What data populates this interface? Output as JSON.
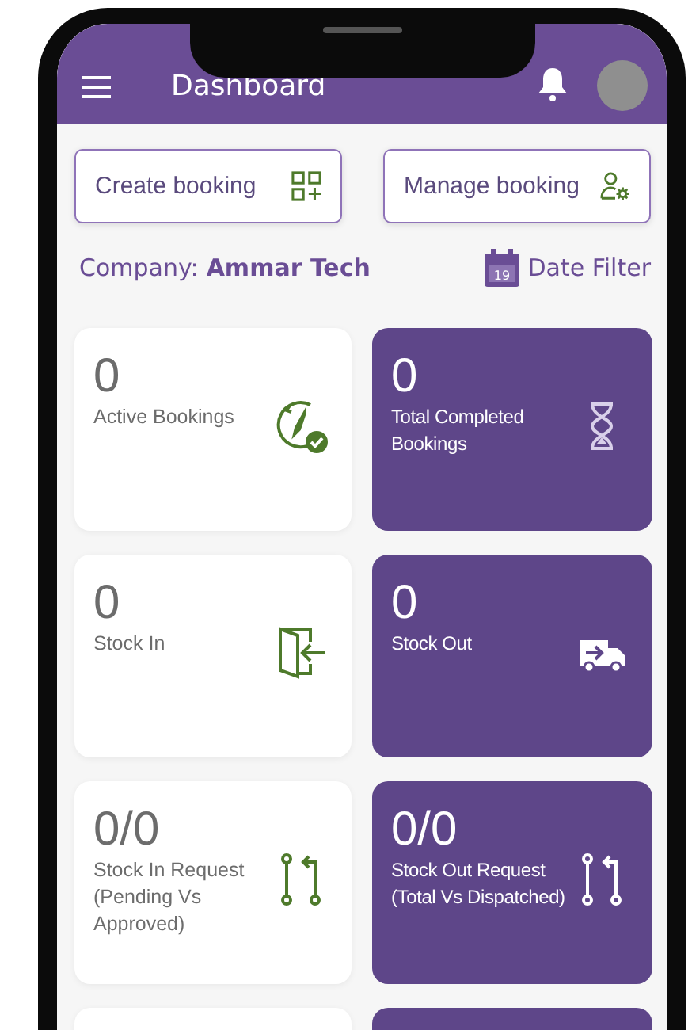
{
  "header": {
    "title": "Dashboard"
  },
  "actions": [
    {
      "label": "Create booking"
    },
    {
      "label": "Manage booking"
    }
  ],
  "company": {
    "label": "Company:",
    "value": "Ammar Tech"
  },
  "date_filter": {
    "label": "Date Filter",
    "day": "19"
  },
  "cards": [
    {
      "value": "0",
      "label": "Active Bookings"
    },
    {
      "value": "0",
      "label": "Total Completed Bookings"
    },
    {
      "value": "0",
      "label": "Stock In"
    },
    {
      "value": "0",
      "label": "Stock Out"
    },
    {
      "value": "0/0",
      "label": "Stock In Request (Pending Vs Approved)"
    },
    {
      "value": "0/0",
      "label": "Stock Out Request (Total Vs Dispatched)"
    }
  ]
}
